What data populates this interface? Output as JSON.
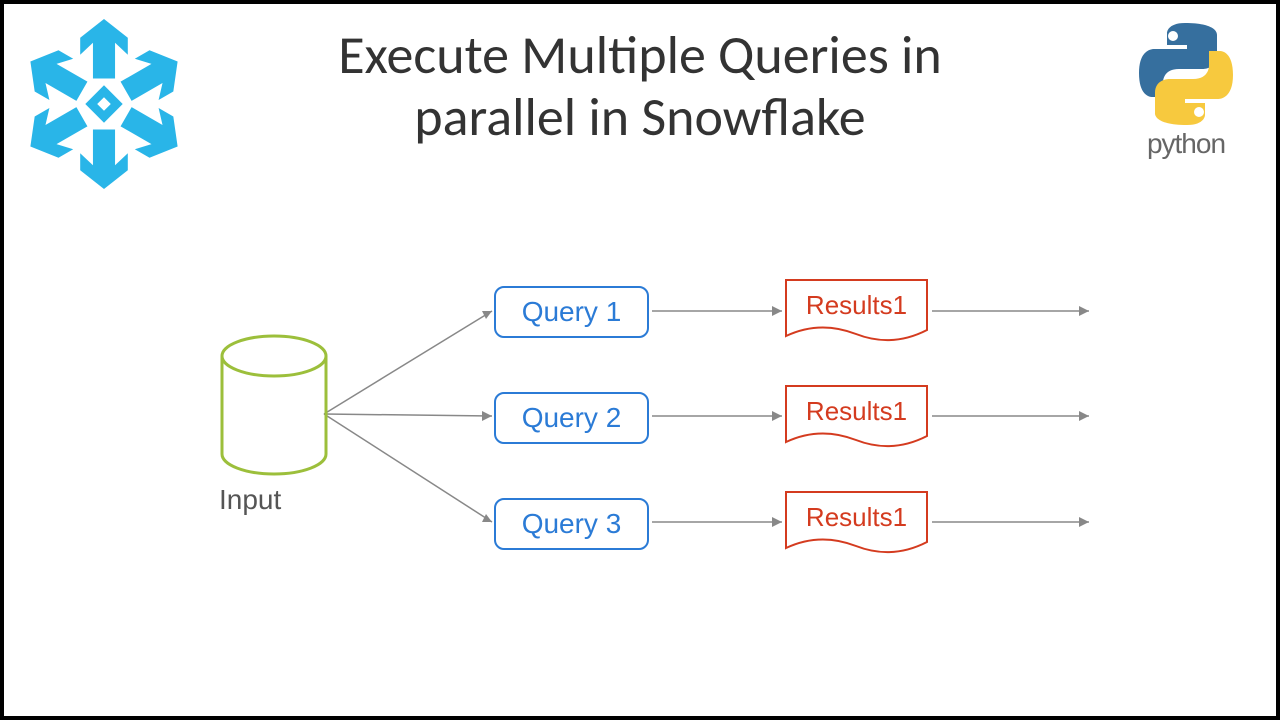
{
  "title_line1": "Execute Multiple Queries in",
  "title_line2": "parallel in Snowflake",
  "logos": {
    "python_label": "python"
  },
  "diagram": {
    "input_label": "Input",
    "queries": [
      {
        "label": "Query 1"
      },
      {
        "label": "Query 2"
      },
      {
        "label": "Query 3"
      }
    ],
    "results": [
      {
        "label": "Results1"
      },
      {
        "label": "Results1"
      },
      {
        "label": "Results1"
      }
    ]
  },
  "colors": {
    "snowflake": "#29b5e8",
    "query_border": "#2b7bd6",
    "result_border": "#d43b1f",
    "input_stroke": "#9cbf3b"
  }
}
